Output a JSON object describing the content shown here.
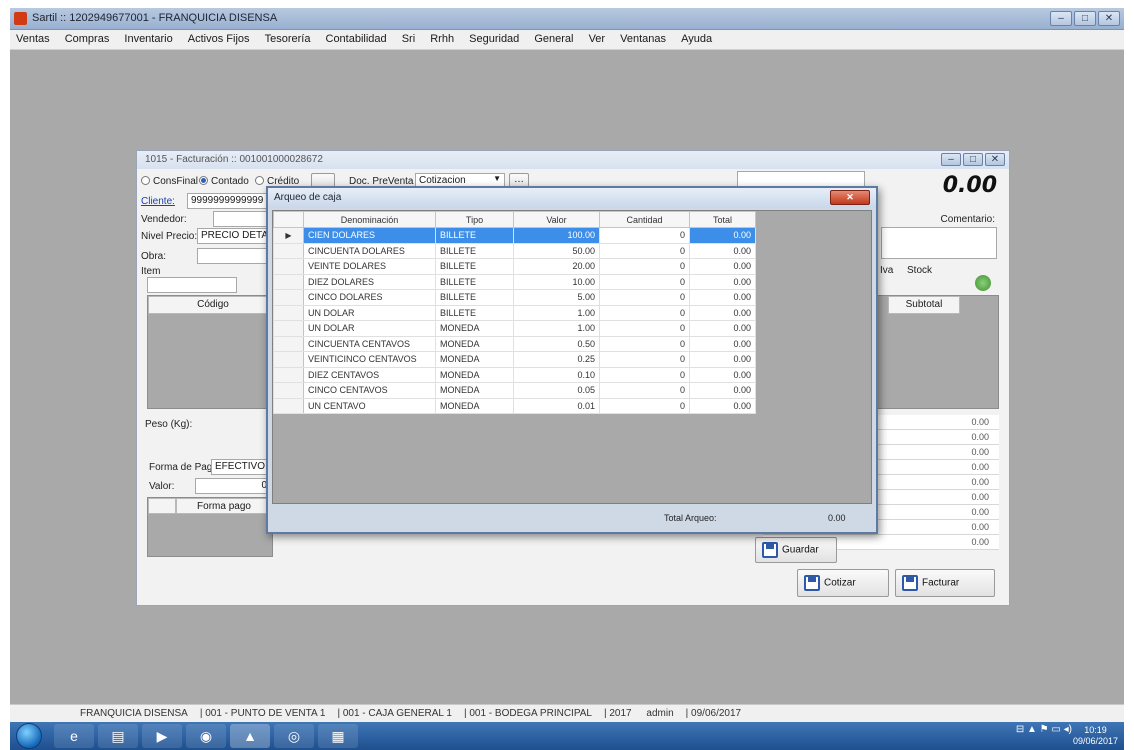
{
  "app": {
    "title": "Sartil :: 1202949677001 - FRANQUICIA DISENSA",
    "menu": [
      "Ventas",
      "Compras",
      "Inventario",
      "Activos Fijos",
      "Tesorería",
      "Contabilidad",
      "Sri",
      "Rrhh",
      "Seguridad",
      "General",
      "Ver",
      "Ventanas",
      "Ayuda"
    ],
    "status": [
      "FRANQUICIA DISENSA",
      "001 - PUNTO DE VENTA 1",
      "001 - CAJA GENERAL 1",
      "001 - BODEGA PRINCIPAL",
      "2017",
      "admin",
      "09/06/2017"
    ]
  },
  "invoice": {
    "title": "1015 - Facturación :: 001001000028672",
    "options": {
      "cf": "ConsFinal",
      "contado": "Contado",
      "credito": "Crédito"
    },
    "doc_label": "Doc. PreVenta",
    "doc_value": "Cotizacion",
    "cliente_label": "Cliente:",
    "cliente_value": "9999999999999",
    "vendedor_label": "Vendedor:",
    "nivel_label": "Nivel Precio:",
    "nivel_value": "PRECIO DETALLE",
    "obra_label": "Obra:",
    "item_label": "Item",
    "total": "0.00",
    "comentario_label": "Comentario:",
    "iva_label": "Iva",
    "stock_label": "Stock",
    "col_codigo": "Código",
    "col_subtotal": "Subtotal",
    "peso_label": "Peso (Kg):",
    "forma_pago_label": "Forma de Pago:",
    "forma_pago_value": "EFECTIVO",
    "valor_label": "Valor:",
    "valor_value": "0",
    "col_forma_pago": "Forma pago",
    "summary_values": [
      "0.00",
      "0.00",
      "0.00",
      "0.00",
      "0.00",
      "0.00",
      "0.00",
      "0.00",
      "0.00"
    ],
    "btn_guardar": "Guardar",
    "btn_cotizar": "Cotizar",
    "btn_facturar": "Facturar"
  },
  "arqueo": {
    "title": "Arqueo de caja",
    "columns": [
      "Denominación",
      "Tipo",
      "Valor",
      "Cantidad",
      "Total"
    ],
    "rows": [
      {
        "denominacion": "CIEN DOLARES",
        "tipo": "BILLETE",
        "valor": "100.00",
        "cantidad": "0",
        "total": "0.00"
      },
      {
        "denominacion": "CINCUENTA DOLARES",
        "tipo": "BILLETE",
        "valor": "50.00",
        "cantidad": "0",
        "total": "0.00"
      },
      {
        "denominacion": "VEINTE DOLARES",
        "tipo": "BILLETE",
        "valor": "20.00",
        "cantidad": "0",
        "total": "0.00"
      },
      {
        "denominacion": "DIEZ DOLARES",
        "tipo": "BILLETE",
        "valor": "10.00",
        "cantidad": "0",
        "total": "0.00"
      },
      {
        "denominacion": "CINCO DOLARES",
        "tipo": "BILLETE",
        "valor": "5.00",
        "cantidad": "0",
        "total": "0.00"
      },
      {
        "denominacion": "UN DOLAR",
        "tipo": "BILLETE",
        "valor": "1.00",
        "cantidad": "0",
        "total": "0.00"
      },
      {
        "denominacion": "UN DOLAR",
        "tipo": "MONEDA",
        "valor": "1.00",
        "cantidad": "0",
        "total": "0.00"
      },
      {
        "denominacion": "CINCUENTA CENTAVOS",
        "tipo": "MONEDA",
        "valor": "0.50",
        "cantidad": "0",
        "total": "0.00"
      },
      {
        "denominacion": "VEINTICINCO CENTAVOS",
        "tipo": "MONEDA",
        "valor": "0.25",
        "cantidad": "0",
        "total": "0.00"
      },
      {
        "denominacion": "DIEZ CENTAVOS",
        "tipo": "MONEDA",
        "valor": "0.10",
        "cantidad": "0",
        "total": "0.00"
      },
      {
        "denominacion": "CINCO CENTAVOS",
        "tipo": "MONEDA",
        "valor": "0.05",
        "cantidad": "0",
        "total": "0.00"
      },
      {
        "denominacion": "UN CENTAVO",
        "tipo": "MONEDA",
        "valor": "0.01",
        "cantidad": "0",
        "total": "0.00"
      }
    ],
    "total_label": "Total Arqueo:",
    "total_value": "0.00"
  },
  "taskbar": {
    "time": "10:19",
    "date": "09/06/2017"
  },
  "colors": {
    "selection": "#3c8ee8",
    "workspace": "#a9a9a9",
    "taskbar": "#1e4f8f"
  }
}
